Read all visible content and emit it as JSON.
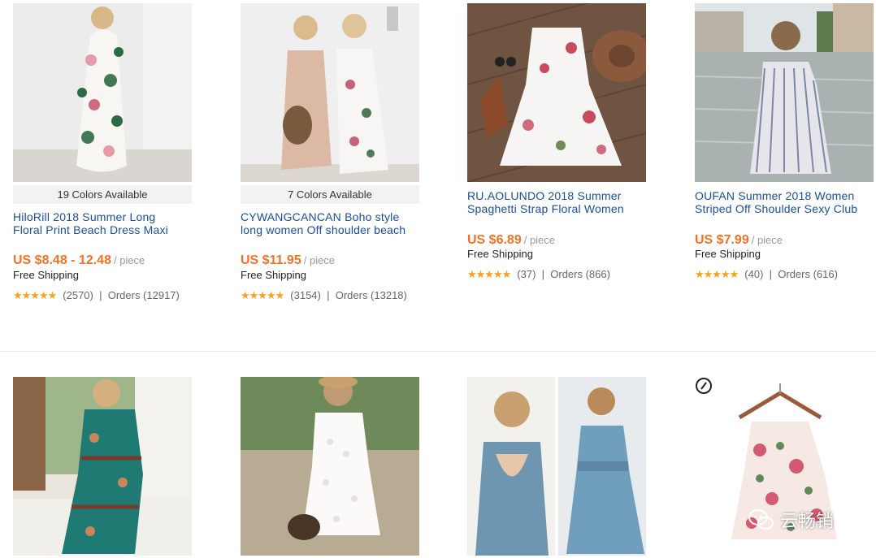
{
  "colors": {
    "link": "#1a4fa0",
    "price": "#f57224",
    "star": "#f6a21c"
  },
  "products": [
    {
      "colors_available": "19 Colors Available",
      "title_line1": "HiloRill 2018 Summer Long",
      "title_line2": "Floral Print Beach Dress Maxi",
      "price": "US $8.48 - 12.48",
      "unit": "/ piece",
      "shipping": "Free Shipping",
      "stars": "★★★★★",
      "reviews": "(2570)",
      "orders": "Orders (12917)"
    },
    {
      "colors_available": "7 Colors Available",
      "title_line1": "CYWANGCANCAN Boho style",
      "title_line2": "long women Off shoulder beach",
      "price": "US $11.95",
      "unit": "/ piece",
      "shipping": "Free Shipping",
      "stars": "★★★★★",
      "reviews": "(3154)",
      "orders": "Orders (13218)"
    },
    {
      "title_line1": "RU.AOLUNDO 2018 Summer",
      "title_line2": "Spaghetti Strap Floral Women",
      "price": "US $6.89",
      "unit": "/ piece",
      "shipping": "Free Shipping",
      "stars": "★★★★★",
      "reviews": "(37)",
      "orders": "Orders (866)"
    },
    {
      "title_line1": "OUFAN Summer 2018 Women",
      "title_line2": "Striped Off Shoulder Sexy Club",
      "price": "US $7.99",
      "unit": "/ piece",
      "shipping": "Free Shipping",
      "stars": "★★★★★",
      "reviews": "(40)",
      "orders": "Orders (616)"
    }
  ],
  "watermark": {
    "text": "云畅销",
    "icon": "wechat-icon"
  }
}
